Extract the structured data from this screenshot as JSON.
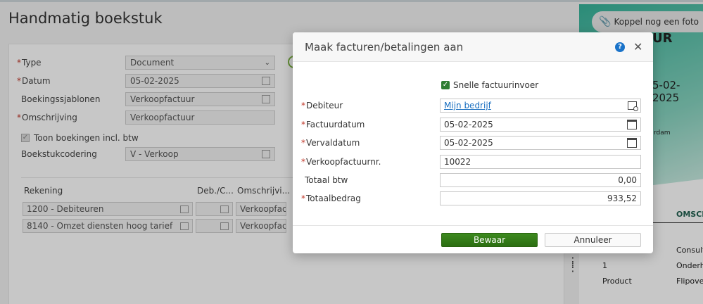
{
  "page": {
    "title": "Handmatig boekstuk",
    "form": {
      "type_label": "Type",
      "type_value": "Document",
      "datum_label": "Datum",
      "datum_value": "05-02-2025",
      "sjablonen_label": "Boekingssjablonen",
      "sjablonen_value": "Verkoopfactuur",
      "omschrijving_label": "Omschrijving",
      "omschrijving_value": "Verkoopfactuur",
      "toon_label": "Toon boekingen incl. btw",
      "codering_label": "Boekstukcodering",
      "codering_value": "V - Verkoop"
    },
    "table": {
      "columns": [
        "Rekening",
        "Deb./C...",
        "Omschrijvi..."
      ],
      "rows": [
        {
          "rekening": "1200 - Debiteuren",
          "omschrijving": "Verkoopfact"
        },
        {
          "rekening": "8140 - Omzet diensten hoog tarief",
          "omschrijving": "Verkoopfact"
        }
      ]
    }
  },
  "preview": {
    "koppel_label": "Koppel nog een foto",
    "heading_fragment": "UR",
    "date_fragment": "5-02-2025",
    "city_fragment": "rdam",
    "col_header": "OMSCH",
    "lines": [
      {
        "qty": "",
        "desc": "Consult"
      },
      {
        "qty": "1",
        "desc": "Onderho"
      },
      {
        "qty": "Product",
        "desc": "Flipove"
      }
    ]
  },
  "modal": {
    "title": "Maak facturen/betalingen aan",
    "snelle_label": "Snelle factuurinvoer",
    "fields": {
      "debiteur_label": "Debiteur",
      "debiteur_value": "Mijn bedrijf",
      "factuurdatum_label": "Factuurdatum",
      "factuurdatum_value": "05-02-2025",
      "vervaldatum_label": "Vervaldatum",
      "vervaldatum_value": "05-02-2025",
      "factuurnr_label": "Verkoopfactuurnr.",
      "factuurnr_value": "10022",
      "btw_label": "Totaal btw",
      "btw_value": "0,00",
      "totaal_label": "Totaalbedrag",
      "totaal_value": "933,52"
    },
    "save_label": "Bewaar",
    "cancel_label": "Annuleer"
  },
  "colors": {
    "accent_green": "#2e7d32",
    "link_blue": "#1a6fc0",
    "teal": "#37b39a"
  },
  "icons": [
    "dropdown-icon",
    "calendar-icon",
    "lookup-icon",
    "help-icon",
    "close-icon",
    "paperclip-icon",
    "drag-handle-icon"
  ]
}
